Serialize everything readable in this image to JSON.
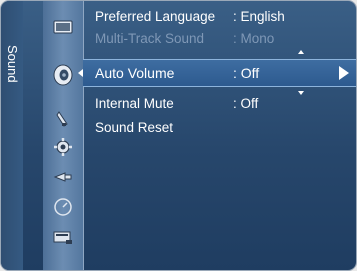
{
  "side_tab": {
    "label": "Sound"
  },
  "icons": [
    {
      "name": "picture-icon"
    },
    {
      "name": "sound-icon"
    },
    {
      "name": "channel-icon"
    },
    {
      "name": "setup-icon"
    },
    {
      "name": "input-icon"
    },
    {
      "name": "application-icon"
    },
    {
      "name": "support-icon"
    }
  ],
  "menu": {
    "items": [
      {
        "label": "Preferred Language",
        "value": ": English",
        "state": "normal"
      },
      {
        "label": "Multi-Track Sound",
        "value": ": Mono",
        "state": "disabled"
      },
      {
        "label": "Auto Volume",
        "value": ": Off",
        "state": "selected"
      },
      {
        "label": "Internal Mute",
        "value": ": Off",
        "state": "normal"
      },
      {
        "label": "Sound Reset",
        "value": "",
        "state": "normal"
      }
    ]
  },
  "colors": {
    "panel": "#27476c",
    "selected": "#3e6da1",
    "disabled_text": "#7f98b6",
    "text": "#ffffff"
  }
}
